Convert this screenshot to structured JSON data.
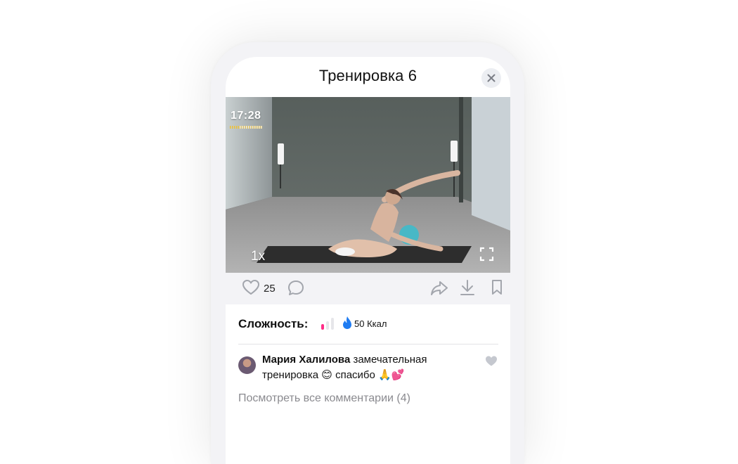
{
  "header": {
    "title": "Тренировка 6"
  },
  "video": {
    "timer": "17:28",
    "speed": "1x"
  },
  "actions": {
    "likes_count": "25"
  },
  "stats": {
    "difficulty_label": "Сложность:",
    "difficulty_level": 1,
    "difficulty_max": 3,
    "calories": "50 Ккал"
  },
  "comment": {
    "author": "Мария Халилова",
    "text": "замечательная тренировка 😊 спасибо 🙏💕"
  },
  "view_all_comments": "Посмотреть все комментарии (4)",
  "colors": {
    "accent_pink": "#ff2d87",
    "flame_blue": "#1f7cf2",
    "icon_gray": "#a3a6ad",
    "timer_progress": "#f1c232"
  }
}
